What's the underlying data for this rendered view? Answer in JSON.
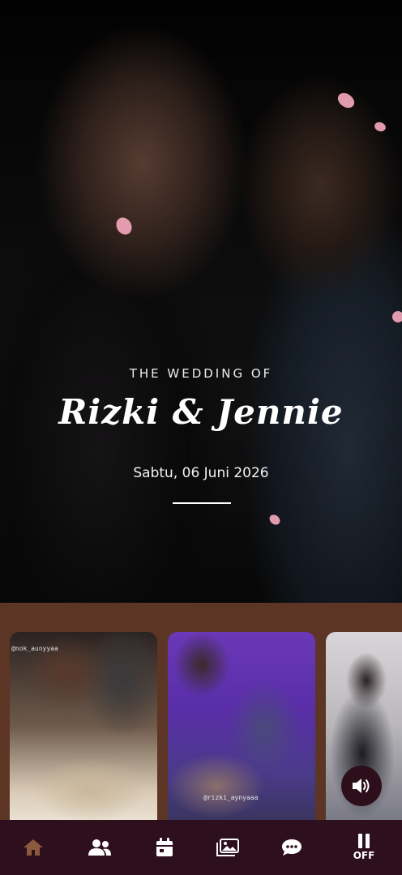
{
  "hero": {
    "kicker": "THE WEDDING OF",
    "names": "Rizki & Jennie",
    "date": "Sabtu, 06 Juni 2026"
  },
  "gallery": {
    "photos": [
      {
        "watermark": "@nok_aunyyaa"
      },
      {
        "watermark": "@rizki_aynyaaa"
      },
      {
        "watermark": ""
      }
    ]
  },
  "sound_button": {
    "icon": "volume-icon"
  },
  "nav": {
    "items": [
      {
        "name": "home",
        "icon": "home-icon"
      },
      {
        "name": "couple",
        "icon": "users-icon"
      },
      {
        "name": "event",
        "icon": "calendar-icon"
      },
      {
        "name": "gallery",
        "icon": "images-icon"
      },
      {
        "name": "wishes",
        "icon": "chat-icon"
      },
      {
        "name": "music",
        "icon": "pause-icon",
        "label": "OFF"
      }
    ]
  },
  "colors": {
    "gallery_bg": "#5c3525",
    "nav_bg": "#2e0f1e",
    "nav_active": "#8a5a3c",
    "petal": "#f2a7bb"
  }
}
